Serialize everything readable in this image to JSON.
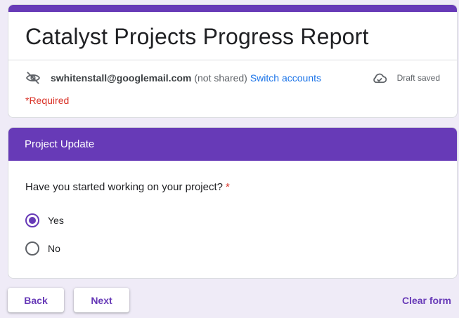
{
  "form": {
    "title": "Catalyst Projects Progress Report",
    "accent_color": "#673ab7"
  },
  "account": {
    "icon": "eye-off-icon",
    "email": "swhitenstall@googlemail.com",
    "shared_status": "(not shared)",
    "switch_label": "Switch accounts"
  },
  "draft": {
    "icon": "cloud-check-icon",
    "status": "Draft saved"
  },
  "required_note": "*Required",
  "section": {
    "title": "Project Update",
    "question": {
      "text": "Have you started working on your project?",
      "required_mark": "*",
      "options": [
        {
          "label": "Yes",
          "selected": true
        },
        {
          "label": "No",
          "selected": false
        }
      ]
    }
  },
  "footer": {
    "back_label": "Back",
    "next_label": "Next",
    "clear_label": "Clear form"
  }
}
